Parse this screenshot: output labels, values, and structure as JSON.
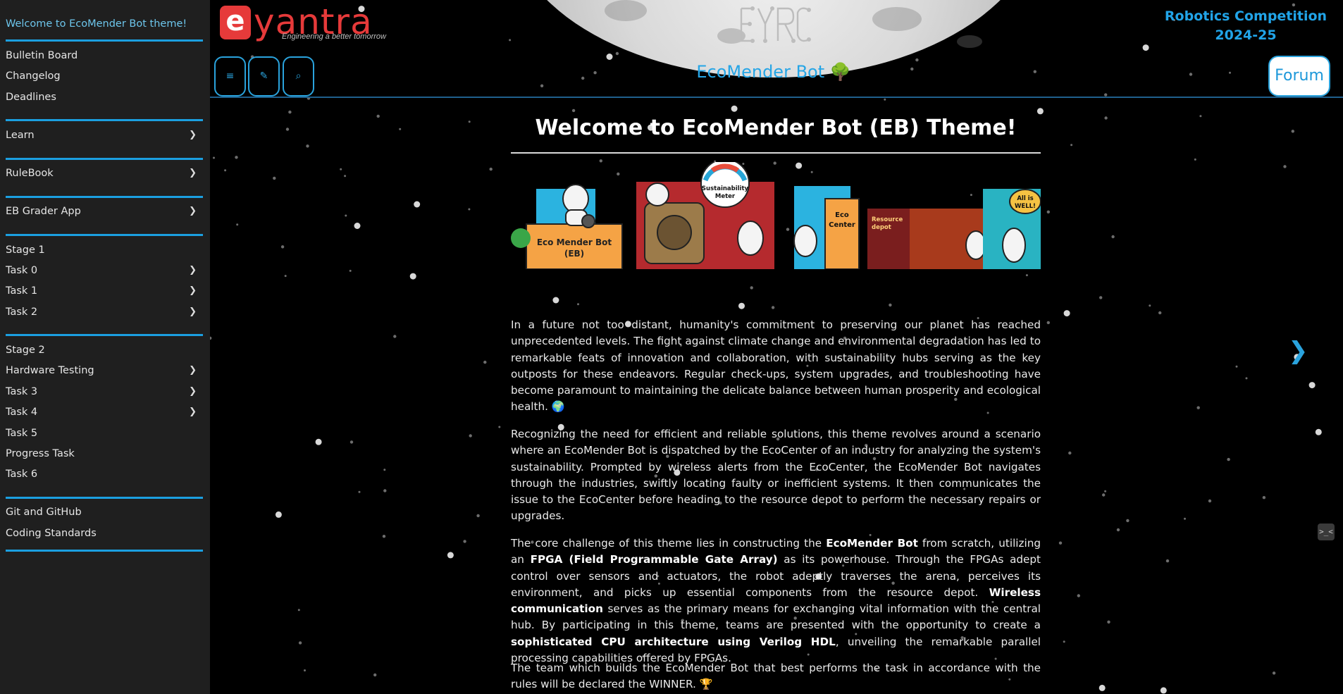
{
  "sidebar": {
    "items": [
      {
        "label": "Welcome to EcoMender Bot theme!",
        "chevron": false,
        "active": true
      },
      {
        "label": "Bulletin Board",
        "chevron": false
      },
      {
        "label": "Changelog",
        "chevron": false
      },
      {
        "label": "Deadlines",
        "chevron": false
      },
      {
        "label": "Learn",
        "chevron": true
      },
      {
        "label": "RuleBook",
        "chevron": true
      },
      {
        "label": "EB Grader App",
        "chevron": true
      },
      {
        "label": "Stage 1",
        "chevron": false
      },
      {
        "label": "Task 0",
        "chevron": true
      },
      {
        "label": "Task 1",
        "chevron": true
      },
      {
        "label": "Task 2",
        "chevron": true
      },
      {
        "label": "Stage 2",
        "chevron": false
      },
      {
        "label": "Hardware Testing",
        "chevron": true
      },
      {
        "label": "Task 3",
        "chevron": true
      },
      {
        "label": "Task 4",
        "chevron": true
      },
      {
        "label": "Task 5",
        "chevron": false
      },
      {
        "label": "Progress Task",
        "chevron": false
      },
      {
        "label": "Task 6",
        "chevron": false
      },
      {
        "label": "Git and GitHub",
        "chevron": false
      },
      {
        "label": "Coding Standards",
        "chevron": false
      }
    ],
    "chevron_glyph": "❯"
  },
  "header": {
    "logo_letter": "e",
    "logo_word": "yantra",
    "logo_tagline": "Engineering a better tomorrow",
    "eyrc_logo": "eYRC",
    "title": "EcoMender Bot 🌳",
    "competition_line1": "Robotics Competition",
    "competition_line2": "2024-25",
    "forum_label": "Forum",
    "buttons": [
      {
        "name": "menu-button",
        "icon": "hamburger-icon",
        "glyph": "≡"
      },
      {
        "name": "theme-button",
        "icon": "paintbrush-icon",
        "glyph": "✎"
      },
      {
        "name": "search-button",
        "icon": "search-icon",
        "glyph": "⌕"
      }
    ]
  },
  "content": {
    "title": "Welcome to EcoMender Bot (EB) Theme!",
    "banner": {
      "sign_text_1": "Eco Mender Bot",
      "sign_text_2": "(EB)",
      "meter_text_1": "Sustainability",
      "meter_text_2": "Meter",
      "eco_center_1": "Eco",
      "eco_center_2": "Center",
      "resource_1": "Resource",
      "resource_2": "depot",
      "bubble_1": "All is",
      "bubble_2": "WELL!"
    },
    "p1": "In a future not too distant, humanity's commitment to preserving our planet has reached unprecedented levels. The fight against climate change and environmental degradation has led to remarkable feats of innovation and collaboration, with sustainability hubs serving as the key outposts for these endeavors. Regular check-ups, system upgrades, and troubleshooting have become paramount to maintaining the delicate balance between human prosperity and ecological health. 🌍",
    "p2": "Recognizing the need for efficient and reliable solutions, this theme revolves around a scenario where an EcoMender Bot is dispatched by the EcoCenter of an industry for analyzing the system's sustainability. Prompted by wireless alerts from the EcoCenter, the EcoMender Bot navigates through the industries, swiftly locating faulty or inefficient systems. It then communicates the issue to the EcoCenter before heading to the resource depot to perform the necessary repairs or upgrades.",
    "p3": {
      "t1": "The core challenge of this theme lies in constructing the ",
      "b1": "EcoMender Bot",
      "t2": " from scratch, utilizing an ",
      "b2": "FPGA (Field Programmable Gate Array)",
      "t3": " as its powerhouse. Through the FPGAs adept control over sensors and actuators, the robot adeptly traverses the arena, perceives its environment, and picks up essential components from the resource depot. ",
      "b3": "Wireless communication",
      "t4": " serves as the primary means for exchanging vital information with the central hub. By participating in this theme, teams are presented with the opportunity to create a ",
      "b4": "sophisticated CPU architecture using Verilog HDL",
      "t5": ", unveiling the remarkable parallel processing capabilities offered by FPGAs."
    },
    "p4": "The team which builds the EcoMender Bot that best performs the task in accordance with the rules will be declared the WINNER. 🏆"
  },
  "colors": {
    "accent": "#1b9fe0",
    "sidebar_bg": "#1f1f1f",
    "logo_red": "#e63a3a"
  },
  "next_arrow": "❯",
  "terminal_icon": ">_<"
}
